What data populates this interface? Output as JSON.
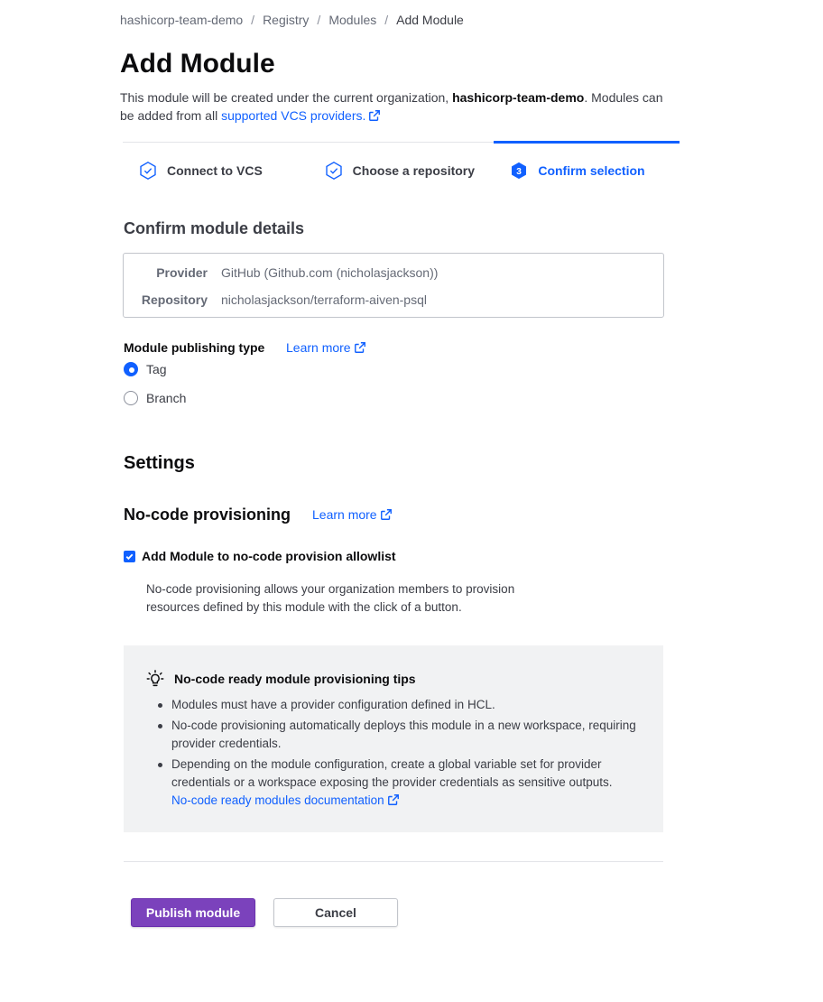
{
  "breadcrumb": {
    "items": [
      "hashicorp-team-demo",
      "Registry",
      "Modules"
    ],
    "current": "Add Module",
    "separator": "/"
  },
  "page": {
    "title": "Add Module",
    "intro_prefix": "This module will be created under the current organization, ",
    "intro_org": "hashicorp-team-demo",
    "intro_suffix": ". Modules can be added from all ",
    "intro_link": "supported VCS providers."
  },
  "steps": [
    {
      "label": "Connect to VCS",
      "state": "complete"
    },
    {
      "label": "Choose a repository",
      "state": "complete"
    },
    {
      "label": "Confirm selection",
      "state": "active",
      "number": "3"
    }
  ],
  "confirm": {
    "heading": "Confirm module details",
    "provider_label": "Provider",
    "provider_value": "GitHub (Github.com (nicholasjackson))",
    "repository_label": "Repository",
    "repository_value": "nicholasjackson/terraform-aiven-psql"
  },
  "publishing": {
    "label": "Module publishing type",
    "learn_more": "Learn more",
    "options": [
      {
        "label": "Tag",
        "selected": true
      },
      {
        "label": "Branch",
        "selected": false
      }
    ]
  },
  "settings": {
    "heading": "Settings",
    "nocode_heading": "No-code provisioning",
    "learn_more": "Learn more",
    "checkbox_label": "Add Module to no-code provision allowlist",
    "checkbox_checked": true,
    "help_text": "No-code provisioning allows your organization members to provision resources defined by this module with the click of a button."
  },
  "tips": {
    "title": "No-code ready module provisioning tips",
    "items": [
      "Modules must have a provider configuration defined in HCL.",
      "No-code provisioning automatically deploys this module in a new workspace, requiring provider credentials.",
      "Depending on the module configuration, create a global variable set for provider credentials or a workspace exposing the provider credentials as sensitive outputs."
    ],
    "doc_link": "No-code ready modules documentation"
  },
  "actions": {
    "publish": "Publish module",
    "cancel": "Cancel"
  },
  "colors": {
    "accent": "#1060ff",
    "primary_button": "#7b42bc",
    "tips_background": "#f1f2f3"
  }
}
